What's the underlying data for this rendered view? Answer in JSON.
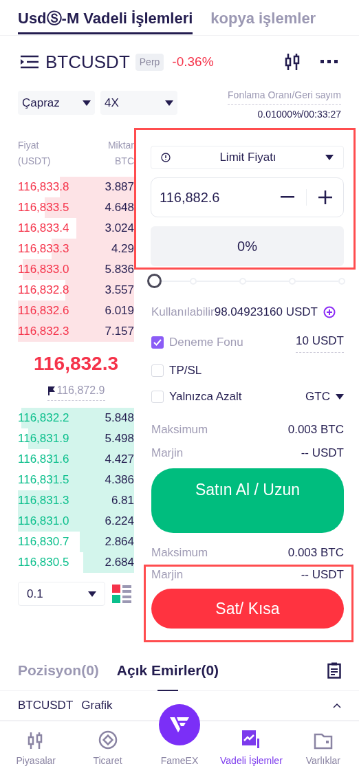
{
  "top_tabs": [
    {
      "label": "UsdⓈ-M Vadeli İşlemleri",
      "selected": true
    },
    {
      "label": "kopya işlemler",
      "selected": false
    }
  ],
  "symbol": {
    "name": "BTCUSDT",
    "badge": "Perp",
    "change": "-0.36%"
  },
  "margin_mode": "Çapraz",
  "leverage": "4X",
  "funding": {
    "label": "Fonlama Oranı/Geri sayım",
    "value": "0.01000%/00:33:27"
  },
  "order_book": {
    "price_header": [
      "Fiyat",
      "(USDT)"
    ],
    "qty_header": [
      "Miktar",
      "BTC"
    ],
    "asks": [
      {
        "price": "116,833.8",
        "qty": "3.887"
      },
      {
        "price": "116,833.5",
        "qty": "4.648"
      },
      {
        "price": "116,833.4",
        "qty": "3.024"
      },
      {
        "price": "116,833.3",
        "qty": "4.29"
      },
      {
        "price": "116,833.0",
        "qty": "5.836"
      },
      {
        "price": "116,832.8",
        "qty": "3.557"
      },
      {
        "price": "116,832.6",
        "qty": "6.019"
      },
      {
        "price": "116,832.3",
        "qty": "7.157"
      }
    ],
    "last_price": "116,832.3",
    "mark_price": "116,872.9",
    "bids": [
      {
        "price": "116,832.2",
        "qty": "5.848"
      },
      {
        "price": "116,831.9",
        "qty": "5.498"
      },
      {
        "price": "116,831.6",
        "qty": "4.427"
      },
      {
        "price": "116,831.5",
        "qty": "4.386"
      },
      {
        "price": "116,831.3",
        "qty": "6.81"
      },
      {
        "price": "116,831.0",
        "qty": "6.224"
      },
      {
        "price": "116,830.7",
        "qty": "2.864"
      },
      {
        "price": "116,830.5",
        "qty": "2.684"
      }
    ],
    "precision": "0.1"
  },
  "order_form": {
    "highlighted": true,
    "order_type": "Limit Fiyatı",
    "price": "116,882.6",
    "percent": "0%"
  },
  "slider": {
    "level": 0
  },
  "available": {
    "label": "Kullanılabilir",
    "value": "98.04923160 USDT"
  },
  "options": [
    {
      "label": "Deneme Fonu",
      "checked": true,
      "value": "10 USDT"
    },
    {
      "label": "TP/SL",
      "checked": false
    },
    {
      "label": "Yalnızca Azalt",
      "checked": false,
      "value": "GTC"
    }
  ],
  "buy": {
    "max_label": "Maksimum",
    "max": "0.003 BTC",
    "margin_label": "Marjin",
    "margin": "-- USDT",
    "button": "Satın Al / Uzun"
  },
  "sell": {
    "max_label": "Maksimum",
    "max": "0.003 BTC",
    "highlighted": true,
    "margin_label": "Marjin",
    "margin": "-- USDT",
    "button": "Sat/ Kısa"
  },
  "bottom_tabs": [
    {
      "label": "Pozisyon(0)",
      "selected": false
    },
    {
      "label": "Açık Emirler(0)",
      "selected": true
    }
  ],
  "chart_bar": {
    "symbol": "BTCUSDT",
    "label": "Grafik"
  },
  "nav": [
    {
      "label": "Piyasalar",
      "kind": "candles",
      "selected": false
    },
    {
      "label": "Ticaret",
      "kind": "trade",
      "selected": false
    },
    {
      "label": "FameEX",
      "kind": "logo",
      "selected": false
    },
    {
      "label": "Vadeli İşlemler",
      "kind": "futures",
      "selected": true
    },
    {
      "label": "Varlıklar",
      "kind": "wallet",
      "selected": false
    }
  ]
}
